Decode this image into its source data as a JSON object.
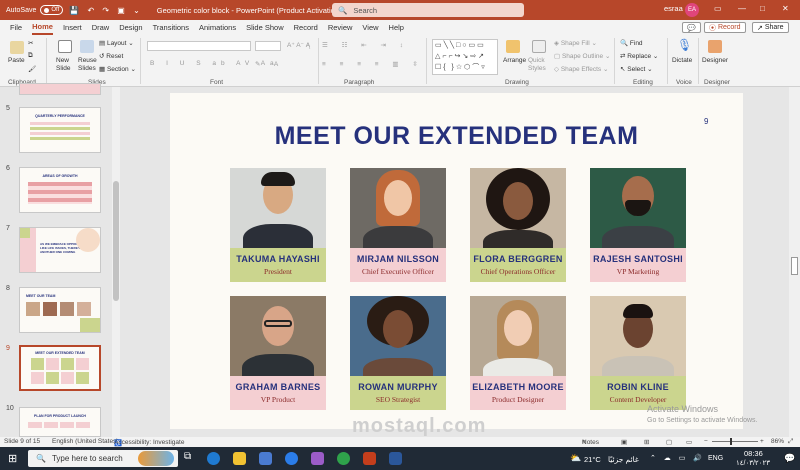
{
  "titlebar": {
    "autosave_label": "AutoSave",
    "autosave_state": "Off",
    "document_title": "Geometric color block  -  PowerPoint (Product Activation Failed)",
    "search_placeholder": "Search",
    "user_name": "esraa ali",
    "user_initials": "EA"
  },
  "tabs": [
    "File",
    "Home",
    "Insert",
    "Draw",
    "Design",
    "Transitions",
    "Animations",
    "Slide Show",
    "Record",
    "Review",
    "View",
    "Help"
  ],
  "tab_actions": {
    "record": "Record",
    "share": "Share"
  },
  "ribbon": {
    "groups": [
      "Clipboard",
      "Slides",
      "Font",
      "Paragraph",
      "Drawing",
      "Editing",
      "Voice",
      "Designer"
    ],
    "paste": "Paste",
    "new_slide": "New Slide",
    "reuse_slides": "Reuse Slides",
    "layout": "Layout",
    "reset": "Reset",
    "section": "Section",
    "arrange": "Arrange",
    "quick_styles": "Quick Styles",
    "shape_fill": "Shape Fill",
    "shape_outline": "Shape Outline",
    "shape_effects": "Shape Effects",
    "find": "Find",
    "replace": "Replace",
    "select": "Select",
    "dictate": "Dictate",
    "designer": "Designer"
  },
  "thumbnails": [
    {
      "number": "5",
      "title": "QUARTERLY PERFORMANCE"
    },
    {
      "number": "6",
      "title": "AREAS OF GROWTH"
    },
    {
      "number": "7",
      "title": "AS WE EMBRACE OPPORTUNITIES LIKE LIFE ISSUES, THERE'S ALWAYS ANOTHER ONE COMING"
    },
    {
      "number": "8",
      "title": "MEET OUR TEAM"
    },
    {
      "number": "9",
      "title": "MEET OUR EXTENDED TEAM"
    },
    {
      "number": "10",
      "title": "PLAN FOR PRODUCT LAUNCH"
    }
  ],
  "slide": {
    "title": "MEET OUR EXTENDED TEAM",
    "page_number": "9",
    "members": [
      {
        "name": "TAKUMA HAYASHI",
        "role": "President"
      },
      {
        "name": "MIRJAM NILSSON",
        "role": "Chief Executive Officer"
      },
      {
        "name": "FLORA BERGGREN",
        "role": "Chief Operations Officer"
      },
      {
        "name": "RAJESH SANTOSHI",
        "role": "VP Marketing"
      },
      {
        "name": "GRAHAM BARNES",
        "role": "VP Product"
      },
      {
        "name": "ROWAN MURPHY",
        "role": "SEO Strategist"
      },
      {
        "name": "ELIZABETH MOORE",
        "role": "Product Designer"
      },
      {
        "name": "ROBIN KLINE",
        "role": "Content Developer"
      }
    ]
  },
  "activation": {
    "title": "Activate Windows",
    "subtitle": "Go to Settings to activate Windows."
  },
  "statusbar": {
    "slide_info": "Slide 9 of 15",
    "language": "English (United States)",
    "accessibility": "Accessibility: Investigate",
    "notes": "Notes",
    "zoom": "86%"
  },
  "taskbar": {
    "search_placeholder": "Type here to search",
    "temperature": "21°C",
    "weather_text": "غائم جزئيًا",
    "language": "ENG",
    "time": "08:36",
    "date": "١٤/٠٣/٢٠٢٣"
  },
  "watermark": "mostaql.com",
  "colors": {
    "accent": "#b7472a",
    "title": "#26317c",
    "green_plate": "#cbd58e",
    "pink_plate": "#f4cfd2"
  }
}
